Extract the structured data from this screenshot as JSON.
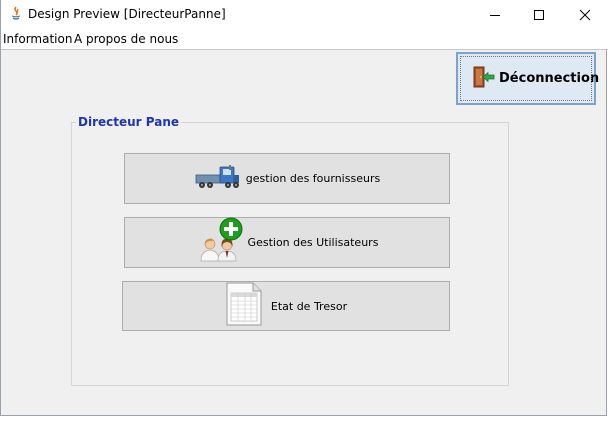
{
  "window": {
    "title": "Design Preview [DirecteurPanne]"
  },
  "menubar": {
    "items": [
      "Information",
      "A propos de nous"
    ]
  },
  "toolbar": {
    "deconnexion_label": "Déconnection"
  },
  "panel": {
    "title": "Directeur Pane",
    "buttons": [
      {
        "label": "gestion des fournisseurs",
        "icon": "truck-icon"
      },
      {
        "label": "Gestion des Utilisateurs",
        "icon": "add-users-icon"
      },
      {
        "label": "Etat de Tresor",
        "icon": "spreadsheet-document-icon"
      }
    ]
  },
  "colors": {
    "panel_title": "#1d35b4",
    "focus_border": "#7da2ce",
    "add_badge": "#1ca01c"
  }
}
